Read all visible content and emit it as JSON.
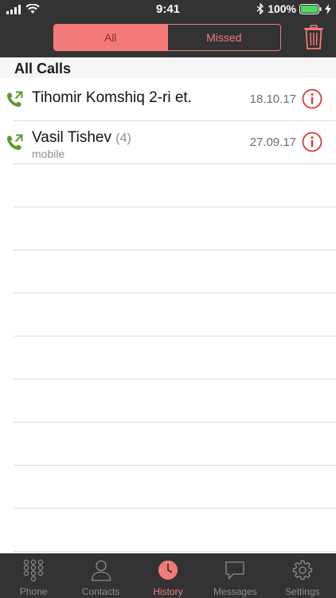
{
  "status_bar": {
    "time": "9:41",
    "battery": "100%"
  },
  "filter": {
    "all_label": "All",
    "missed_label": "Missed",
    "active": "All"
  },
  "section": {
    "title": "All Calls"
  },
  "calls": [
    {
      "name": "Tihomir Komshiq 2-ri et.",
      "count": "",
      "subtitle": "",
      "date": "18.10.17"
    },
    {
      "name": "Vasil Tishev",
      "count": "(4)",
      "subtitle": "mobile",
      "date": "27.09.17"
    }
  ],
  "tabbar": {
    "items": [
      {
        "label": "Phone",
        "icon": "keypad-icon"
      },
      {
        "label": "Contacts",
        "icon": "contacts-icon"
      },
      {
        "label": "History",
        "icon": "clock-icon"
      },
      {
        "label": "Messages",
        "icon": "chat-bubble-icon"
      },
      {
        "label": "Settings",
        "icon": "gear-icon"
      }
    ],
    "active": "History"
  },
  "colors": {
    "accent": "#f47a7a",
    "call_green": "#5c9a2a",
    "info_red": "#d93a3a",
    "dark_bar": "#333333"
  }
}
